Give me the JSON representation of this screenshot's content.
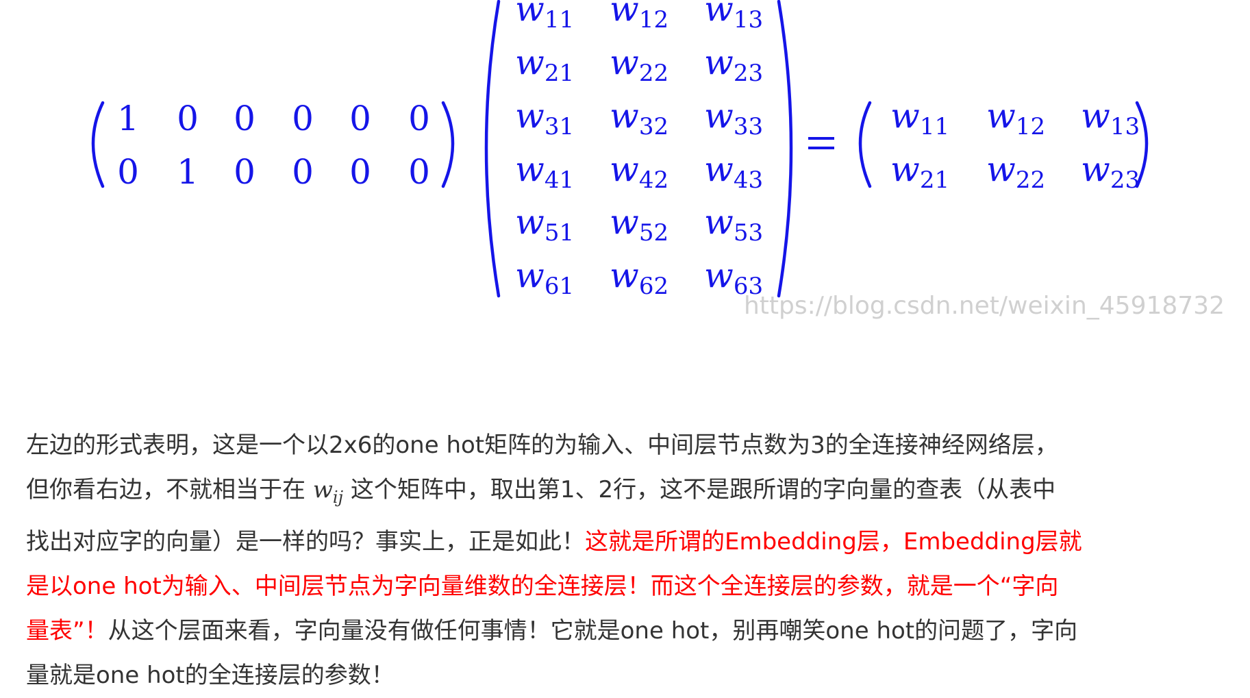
{
  "equation": {
    "onehot_rows": [
      [
        "1",
        "0",
        "0",
        "0",
        "0",
        "0"
      ],
      [
        "0",
        "1",
        "0",
        "0",
        "0",
        "0"
      ]
    ],
    "weight_rows": [
      [
        {
          "b": "w",
          "s": "11"
        },
        {
          "b": "w",
          "s": "12"
        },
        {
          "b": "w",
          "s": "13"
        }
      ],
      [
        {
          "b": "w",
          "s": "21"
        },
        {
          "b": "w",
          "s": "22"
        },
        {
          "b": "w",
          "s": "23"
        }
      ],
      [
        {
          "b": "w",
          "s": "31"
        },
        {
          "b": "w",
          "s": "32"
        },
        {
          "b": "w",
          "s": "33"
        }
      ],
      [
        {
          "b": "w",
          "s": "41"
        },
        {
          "b": "w",
          "s": "42"
        },
        {
          "b": "w",
          "s": "43"
        }
      ],
      [
        {
          "b": "w",
          "s": "51"
        },
        {
          "b": "w",
          "s": "52"
        },
        {
          "b": "w",
          "s": "53"
        }
      ],
      [
        {
          "b": "w",
          "s": "61"
        },
        {
          "b": "w",
          "s": "62"
        },
        {
          "b": "w",
          "s": "63"
        }
      ]
    ],
    "result_rows": [
      [
        {
          "b": "w",
          "s": "11"
        },
        {
          "b": "w",
          "s": "12"
        },
        {
          "b": "w",
          "s": "13"
        }
      ],
      [
        {
          "b": "w",
          "s": "21"
        },
        {
          "b": "w",
          "s": "22"
        },
        {
          "b": "w",
          "s": "23"
        }
      ]
    ],
    "math_color": "#1515e8"
  },
  "watermark": "https://blog.csdn.net/weixin_45918732",
  "paragraph": {
    "line1": "左边的形式表明，这是一个以2x6的one hot矩阵的为输入、中间层节点数为3的全连接神经网络层，",
    "line2_before": "但你看右边，不就相当于在 ",
    "inline_var_base": "w",
    "inline_var_sub": "ij",
    "line2_after": " 这个矩阵中，取出第1、2行，这不是跟所谓的字向量的查表（从表中",
    "line3_normal": "找出对应字的向量）是一样的吗？事实上，正是如此！",
    "line3_red": "这就是所谓的Embedding层，Embedding层就",
    "line4_red": "是以one hot为输入、中间层节点为字向量维数的全连接层！而这个全连接层的参数，就是一个“字向",
    "line5_red": "量表”！",
    "line5_normal": "从这个层面来看，字向量没有做任何事情！它就是one hot，别再嘲笑one hot的问题了，字向",
    "line6": "量就是one hot的全连接层的参数！",
    "text_color": "#333333",
    "highlight_color": "#ff0000"
  }
}
